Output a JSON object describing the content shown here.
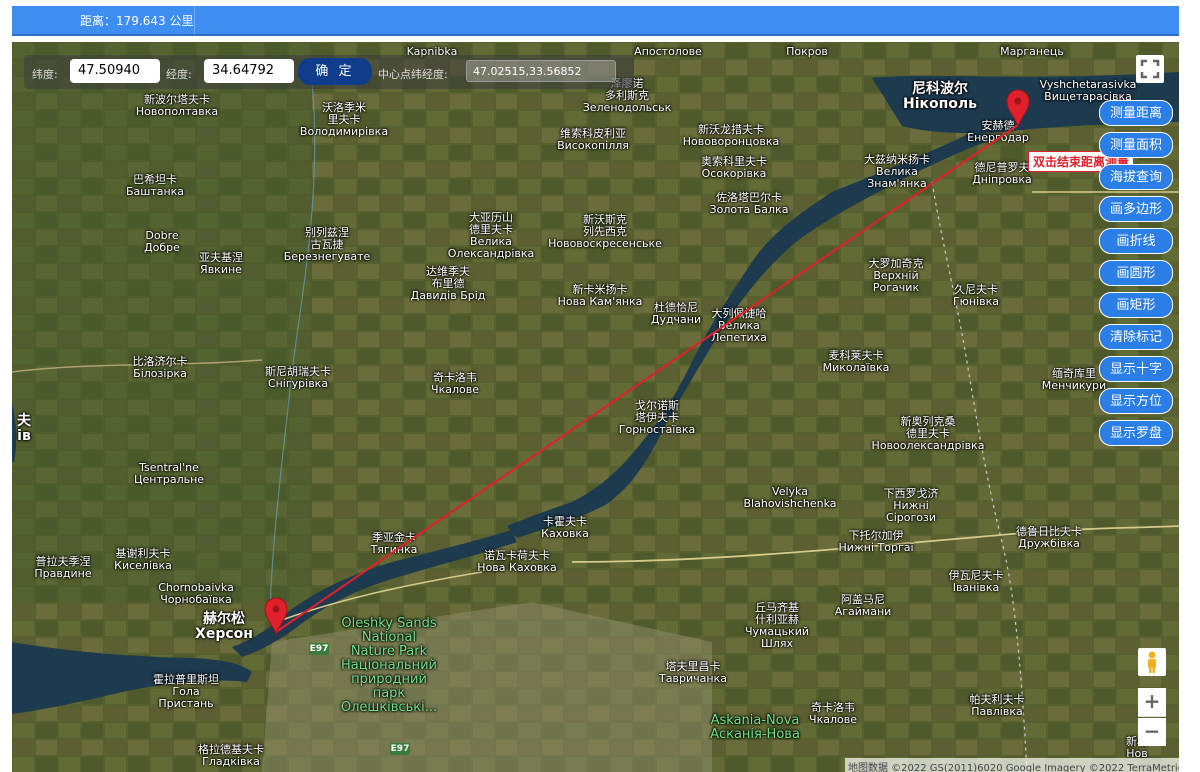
{
  "header": {
    "distance_label": "距离：179.643 公里"
  },
  "coordinates": {
    "lat_label": "纬度:",
    "lat_value": "47.50940",
    "lng_label": "经度:",
    "lng_value": "34.64792",
    "confirm_label": "确 定",
    "center_label": "中心点纬经度:",
    "center_value": "47.02515,33.56852"
  },
  "tools": [
    {
      "label": "测量距离",
      "name": "measure-distance-button"
    },
    {
      "label": "测量面积",
      "name": "measure-area-button"
    },
    {
      "label": "海拔查询",
      "name": "elevation-query-button"
    },
    {
      "label": "画多边形",
      "name": "draw-polygon-button"
    },
    {
      "label": "画折线",
      "name": "draw-polyline-button"
    },
    {
      "label": "画圆形",
      "name": "draw-circle-button"
    },
    {
      "label": "画矩形",
      "name": "draw-rectangle-button"
    },
    {
      "label": "清除标记",
      "name": "clear-markers-button"
    },
    {
      "label": "显示十字",
      "name": "show-crosshair-button"
    },
    {
      "label": "显示方位",
      "name": "show-bearing-button"
    },
    {
      "label": "显示罗盘",
      "name": "show-compass-button"
    }
  ],
  "tooltip": "双击结束距离测量",
  "zoom": {
    "in": "+",
    "out": "−"
  },
  "copyright": "地图数据 ©2022 GS(2011)6020 Google Imagery ©2022 TerraMetrics",
  "roads": [
    "E97",
    "E97"
  ],
  "icons": {
    "fullscreen": "fullscreen-icon",
    "pegman": "pegman-icon",
    "marker": "map-marker-icon"
  },
  "colors": {
    "header": "#3d8ef0",
    "tool_button": "#2a7ee6",
    "confirm_button": "#0f3d8c",
    "route_line": "#e0202a",
    "water": "#1d3a4f"
  },
  "places": [
    [
      "Kapnibka",
      420,
      4,
      ""
    ],
    [
      "Апостолове",
      656,
      4,
      ""
    ],
    [
      "Покров",
      795,
      4,
      ""
    ],
    [
      "Марганець",
      1020,
      4,
      ""
    ],
    [
      "зеленоdolsk_cn",
      615,
      36,
      "泽廖诺\n多利斯克\nЗеленодольськ"
    ],
    [
      "nikopol",
      928,
      40,
      "尼科波尔\nНікополь"
    ],
    [
      "vyshchetarasivka",
      1076,
      37,
      "Vyshchetarasivka\nВищетарасівка"
    ],
    [
      "novopoltavka",
      165,
      52,
      "新波尔塔夫卡\nНовополтавка"
    ],
    [
      "volodymyrivka",
      332,
      60,
      "沃洛季米\n里夫卡\nВолодимирівка"
    ],
    [
      "vysokopillia",
      581,
      86,
      "维索科皮利亚\nВисокопілля"
    ],
    [
      "novovorontsovka",
      719,
      82,
      "新沃龙措夫卡\nНововоронцовка"
    ],
    [
      "osokorivka",
      722,
      114,
      "奥索科里夫卡\nОсокорівка"
    ],
    [
      "velyka_znamianka",
      885,
      112,
      "大兹纳米扬卡\nВелика\nЗнам'янка"
    ],
    [
      "dniprovka",
      990,
      120,
      "德尼普罗夫\nДніпровка"
    ],
    [
      "bashtanka",
      143,
      132,
      "巴希坦卡\nБаштанка"
    ],
    [
      "zolota_balka",
      737,
      150,
      "佐洛塔巴尔卡\nЗолота Балка"
    ],
    [
      "dobre",
      150,
      188,
      "Dobre\nДобре"
    ],
    [
      "yavkyne",
      209,
      210,
      "亚夫基涅\nЯвкине"
    ],
    [
      "bereznehuvate",
      315,
      185,
      "别列兹涅\n古瓦捷\nБерезнегувате"
    ],
    [
      "velyka_oleksandrivka",
      479,
      170,
      "大亚历山\n德里夫卡\nВелика\nОлександрівка"
    ],
    [
      "novovoskresenske",
      593,
      172,
      "新沃斯克\n列先西克\nНововоскресенське"
    ],
    [
      "davydiv_brid",
      436,
      224,
      "达维季夫\n布里德\nДавидів Брід"
    ],
    [
      "verkhnii_rohachyk",
      884,
      216,
      "大罗加奇克\nВерхній\nРогачик"
    ],
    [
      "hiunivka",
      964,
      242,
      "久尼夫卡\nГюнівка"
    ],
    [
      "nova_kamianka",
      588,
      242,
      "新卡米扬卡\nНова Кам'янка"
    ],
    [
      "dudchany",
      664,
      260,
      "杜德恰尼\nДудчани"
    ],
    [
      "velyka_lepetykha",
      727,
      266,
      "大列佩捷哈\nВелика\nЛепетиха"
    ],
    [
      "bilozirka",
      148,
      314,
      "比洛济尔卡\nБілозірка"
    ],
    [
      "snihurivka",
      286,
      324,
      "斯尼胡瑞夫卡\nСнігурівка"
    ],
    [
      "mykolaivka",
      844,
      308,
      "麦科莱夫卡\nМиколаївка"
    ],
    [
      "chkalove",
      443,
      330,
      "奇卡洛韦\nЧкалове"
    ],
    [
      "menchykury",
      1062,
      326,
      "缅奇库里\nМенчикури"
    ],
    [
      "hornostaivka",
      645,
      358,
      "戈尔诺斯\n塔伊夫卡\nГорностаївка"
    ],
    [
      "novooleksandrivka",
      916,
      374,
      "新奥列克桑\n德里夫卡\nНовоолександрівка"
    ],
    [
      "tsentralne",
      157,
      420,
      "Tsentral'ne\nЦентральне"
    ],
    [
      "velyka_blahovishchenka",
      778,
      444,
      "Velyka\nBlahovishchenka"
    ],
    [
      "nyzhni_sirohozy",
      899,
      446,
      "下西罗戈济\nНижні\nСірогози"
    ],
    [
      "kakhovka",
      553,
      474,
      "卡霍夫卡\nКаховка"
    ],
    [
      "tiahynka",
      382,
      490,
      "季亚金卡\nТягинка"
    ],
    [
      "nyzhni_torhai",
      864,
      488,
      "下托尔加伊\nНижні Торгаї"
    ],
    [
      "druzhbivka",
      1037,
      484,
      "德鲁日比夫卡\nДружбівка"
    ],
    [
      "nova_kakhovka",
      505,
      508,
      "诺瓦卡荷夫卡\nНова Каховка"
    ],
    [
      "pravdyne",
      51,
      514,
      "普拉夫季涅\nПравдине"
    ],
    [
      "kyselivka",
      131,
      506,
      "基谢利夫卡\nКиселівка"
    ],
    [
      "ivanivka",
      964,
      528,
      "伊瓦尼夫卡\nІванівка"
    ],
    [
      "chornobaivka",
      184,
      540,
      "Chornobaivka\nЧорнобаївка"
    ],
    [
      "kherson",
      212,
      570,
      "赫尔松\nХерсон"
    ],
    [
      "ahaimany",
      851,
      552,
      "阿盖马尼\nАгаймани"
    ],
    [
      "chumatskyi_shliakh",
      765,
      560,
      "丘马齐基\n什利亚赫\nЧумацький\nШлях"
    ],
    [
      "tavrychanka",
      681,
      619,
      "塔夫里昌卡\nТавричанка"
    ],
    [
      "hola_prystan",
      174,
      632,
      "霍拉普里斯坦\nГола\nПристань"
    ],
    [
      "pavlivka",
      985,
      652,
      "帕夫利夫卡\nПавлівка"
    ],
    [
      "askania_chkalove",
      821,
      660,
      "奇卡洛韦\nЧкалове"
    ],
    [
      "hladkivka",
      219,
      702,
      "格拉德基夫卡\nГладківка"
    ],
    [
      "novo_right",
      1125,
      694,
      "新格\nНов"
    ]
  ]
}
